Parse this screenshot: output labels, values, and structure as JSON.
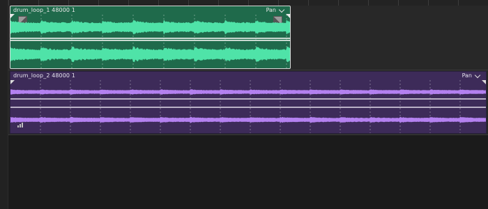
{
  "clips": [
    {
      "title": "drum_loop_1 48000 1",
      "pan_label": "Pan",
      "color_bg": "#1f6a4b",
      "color_wave": "#4fe3a8",
      "icons": [
        "chevron-down-icon",
        "fade-in-handle",
        "fade-out-handle"
      ]
    },
    {
      "title": "drum_loop_2 48000 1",
      "pan_label": "Pan",
      "color_bg": "#3d2b59",
      "color_wave": "#b481f0",
      "icons": [
        "chevron-down-icon",
        "level-meter-icon"
      ]
    }
  ]
}
